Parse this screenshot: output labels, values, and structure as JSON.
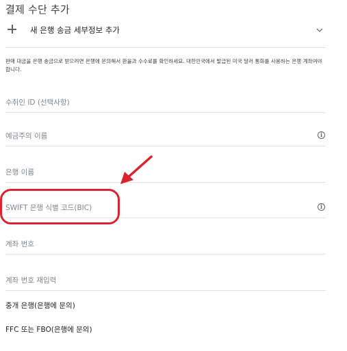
{
  "page": {
    "title": "결제 수단 추가"
  },
  "add_bank": {
    "label": "새 은행 송금 세부정보 추가",
    "icon": "plus-icon",
    "chevron": "chevron-down-icon"
  },
  "notice": {
    "text": "판매 대금을 은행 송금으로 받으려면 은행에 문의해서 환율과 수수료를 확인하세요. 대한민국에서 발급된 미국 달러 통화를 사용하는 은행 계좌여야 합니다."
  },
  "fields": {
    "payee_id": {
      "placeholder": "수취인 ID (선택사항)",
      "value": ""
    },
    "account_holder": {
      "placeholder": "예금주의 이름",
      "value": "",
      "icon": "info-icon"
    },
    "bank_name": {
      "placeholder": "은행 이름",
      "value": ""
    },
    "swift": {
      "placeholder": "SWIFT 은행 식별 코드(BIC)",
      "value": "",
      "icon": "info-icon"
    },
    "account_number": {
      "placeholder": "계좌 번호",
      "value": ""
    },
    "account_number_confirm": {
      "placeholder": "계좌 번호 재입력",
      "value": ""
    }
  },
  "links": {
    "intermediary_bank": "중개 은행(은행에 문의)",
    "ffc_fbo": "FFC 또는 FBO(은행에 문의)"
  },
  "annotation": {
    "color": "#d9232e",
    "shapes": [
      "red-arrow",
      "red-oval"
    ]
  },
  "colors": {
    "text": "#202124",
    "placeholder": "#80868b",
    "divider": "#e0e0e0",
    "icon": "#5f6368"
  }
}
